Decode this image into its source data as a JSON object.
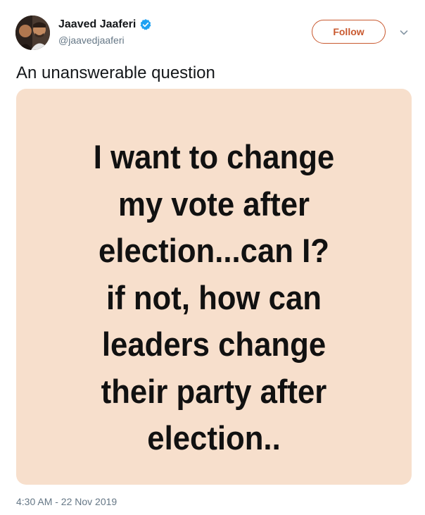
{
  "tweet": {
    "author": {
      "display_name": "Jaaved Jaaferi",
      "handle": "@jaavedjaaferi",
      "verified": true
    },
    "follow_label": "Follow",
    "menu_icon": "chevron-down-icon",
    "text": "An unanswerable question",
    "media": {
      "lines": [
        "I want to change",
        "my vote after",
        "election...can I?",
        "if not, how can",
        "leaders change",
        "their party after",
        "election.."
      ],
      "background_color": "#f7dfcc",
      "text_color": "#111111"
    },
    "timestamp": "4:30 AM - 22 Nov 2019"
  },
  "colors": {
    "accent": "#c9592f",
    "verified": "#1da1f2",
    "muted": "#657786"
  }
}
